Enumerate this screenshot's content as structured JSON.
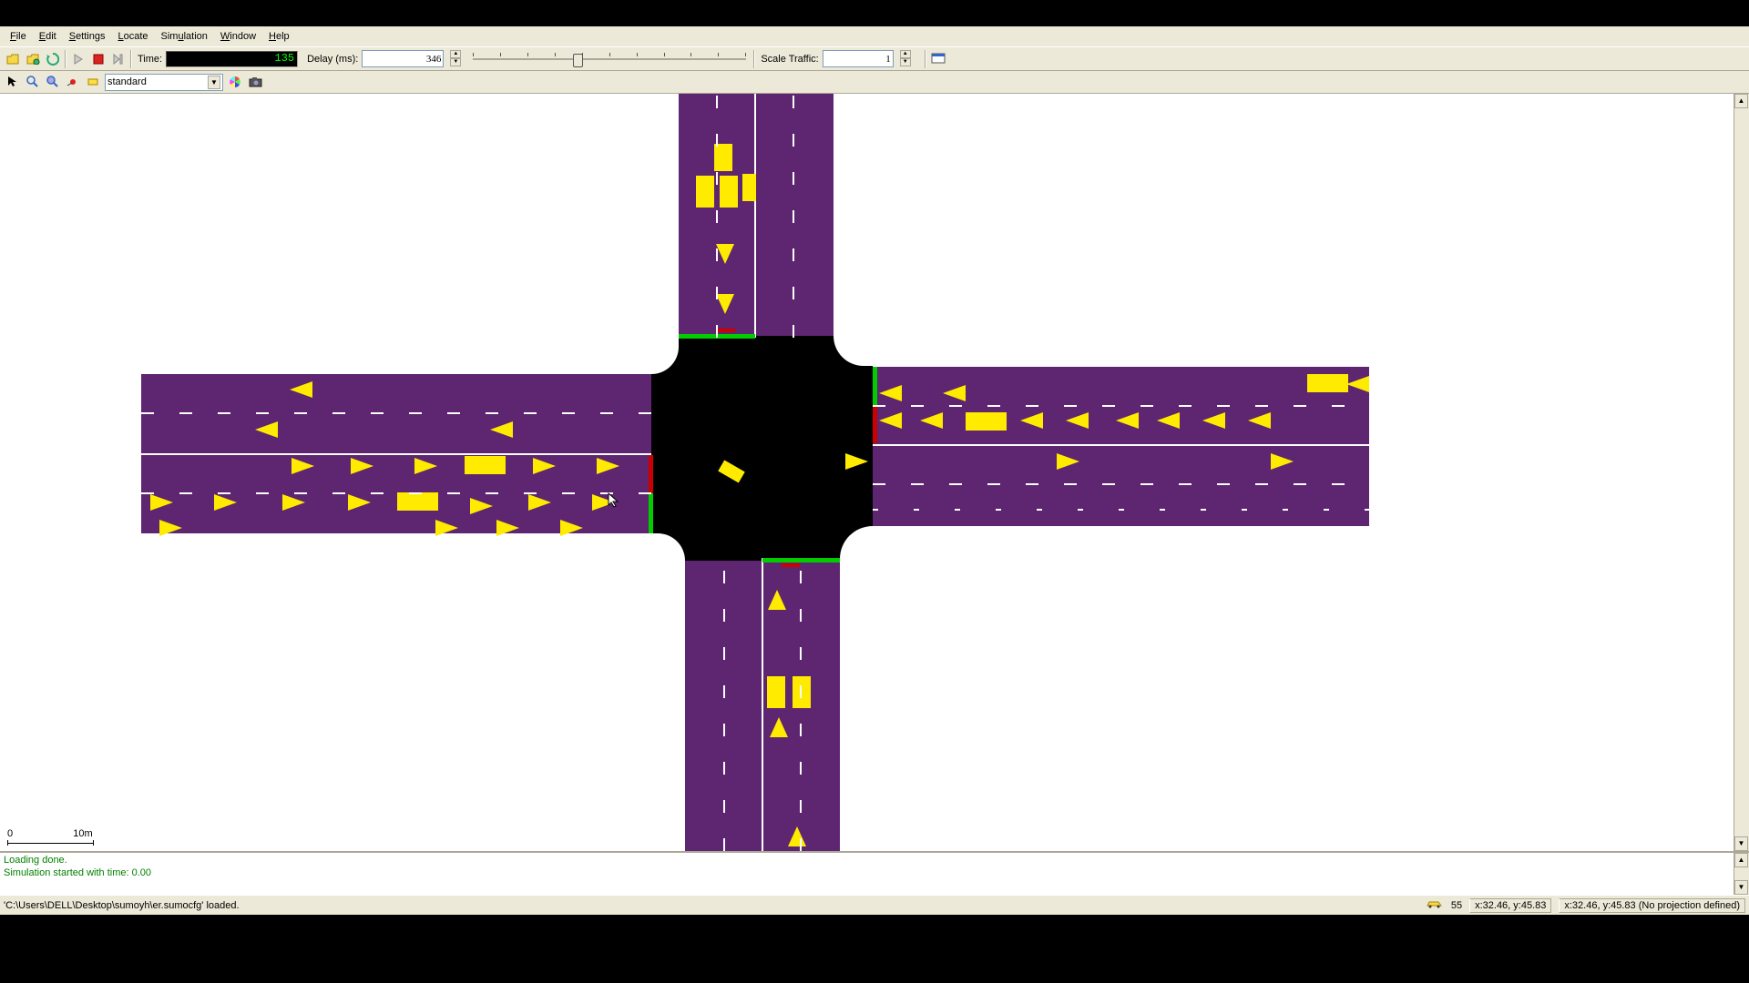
{
  "menu": {
    "file": "File",
    "edit": "Edit",
    "settings": "Settings",
    "locate": "Locate",
    "simulation": "Simulation",
    "window": "Window",
    "help": "Help"
  },
  "toolbar": {
    "time_label": "Time:",
    "time_value": "135",
    "delay_label": "Delay (ms):",
    "delay_value": "346",
    "scale_label": "Scale Traffic:",
    "scale_value": "1"
  },
  "view": {
    "selected": "standard"
  },
  "scale": {
    "left": "0",
    "right": "10m"
  },
  "log": {
    "l1": "Loading done.",
    "l2": "Simulation started with time: 0.00"
  },
  "status": {
    "file": "'C:\\Users\\DELL\\Desktop\\sumoyh\\er.sumocfg' loaded.",
    "count": "55",
    "coord1": "x:32.46, y:45.83",
    "coord2": "x:32.46, y:45.83 (No projection defined)"
  }
}
